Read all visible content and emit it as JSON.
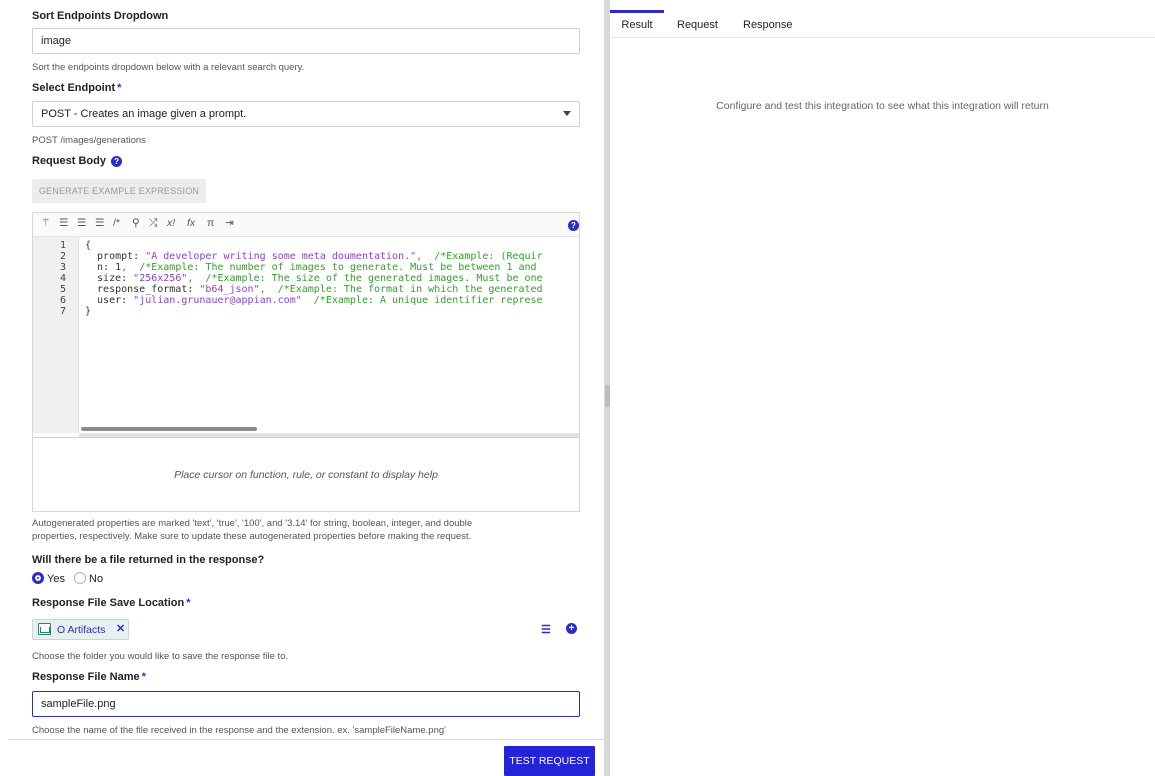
{
  "sort_endpoints": {
    "label": "Sort Endpoints Dropdown",
    "value": "image",
    "help": "Sort the endpoints dropdown below with a relevant search query."
  },
  "select_endpoint": {
    "label": "Select Endpoint",
    "required_mark": "*",
    "value": "POST - Creates an image given a prompt.",
    "help": "POST /images/generations"
  },
  "request_body": {
    "label": "Request Body",
    "generate_button": "GENERATE EXAMPLE EXPRESSION",
    "help_panel_text": "Place cursor on function, rule, or constant to display help",
    "line_numbers": [
      "1",
      "2",
      "3",
      "4",
      "5",
      "6",
      "7"
    ],
    "code_lines": [
      {
        "plain": "{",
        "key": "",
        "str": "",
        "comment": ""
      },
      {
        "plain": "",
        "key": "  prompt: ",
        "str": "\"A developer writing some meta doumentation.\"",
        "comment": ",  /*Example: (Requir"
      },
      {
        "plain": "",
        "key": "  n: ",
        "str": "1",
        "comment": ",  /*Example: The number of images to generate. Must be between 1 and"
      },
      {
        "plain": "",
        "key": "  size: ",
        "str": "\"256x256\"",
        "comment": ",  /*Example: The size of the generated images. Must be one"
      },
      {
        "plain": "",
        "key": "  response_format: ",
        "str": "\"b64_json\"",
        "comment": ",  /*Example: The format in which the generated"
      },
      {
        "plain": "",
        "key": "  user: ",
        "str": "\"julian.grunauer@appian.com\"",
        "comment": "  /*Example: A unique identifier represe"
      },
      {
        "plain": "}",
        "key": "",
        "str": "",
        "comment": ""
      }
    ],
    "autogen_note_line1": "Autogenerated properties are marked 'text', 'true', '100', and '3.14' for string, boolean, integer, and double",
    "autogen_note_line2": "properties, respectively. Make sure to update these autogenerated properties before making the request."
  },
  "file_returned": {
    "label": "Will there be a file returned in the response?",
    "options": [
      "Yes",
      "No"
    ],
    "selected": "Yes"
  },
  "save_location": {
    "label": "Response File Save Location",
    "required_mark": "*",
    "chip_label": "O Artifacts",
    "chip_remove": "✕",
    "help": "Choose the folder you would like to save the response file to."
  },
  "file_name": {
    "label": "Response File Name",
    "required_mark": "*",
    "value": "sampleFile.png",
    "help": "Choose the name of the file received in the response and the extension. ex. 'sampleFileName.png'"
  },
  "test_button": "TEST REQUEST",
  "right_panel": {
    "tabs": [
      "Result",
      "Request",
      "Response"
    ],
    "active_tab": "Result",
    "empty_message": "Configure and test this integration to see what this integration will return"
  },
  "colors": {
    "accent": "#2c2cc8",
    "primary_button": "#2323d8",
    "string": "#8e3fd7",
    "comment": "#33a02c"
  },
  "icons": [
    "magic-wand-icon",
    "indent-icon",
    "outdent-icon",
    "list-icon",
    "comment-icon",
    "search-icon",
    "shuffle-icon",
    "variable-icon",
    "function-icon",
    "pi-icon",
    "export-icon",
    "help-icon",
    "folder-icon",
    "plus-icon"
  ]
}
